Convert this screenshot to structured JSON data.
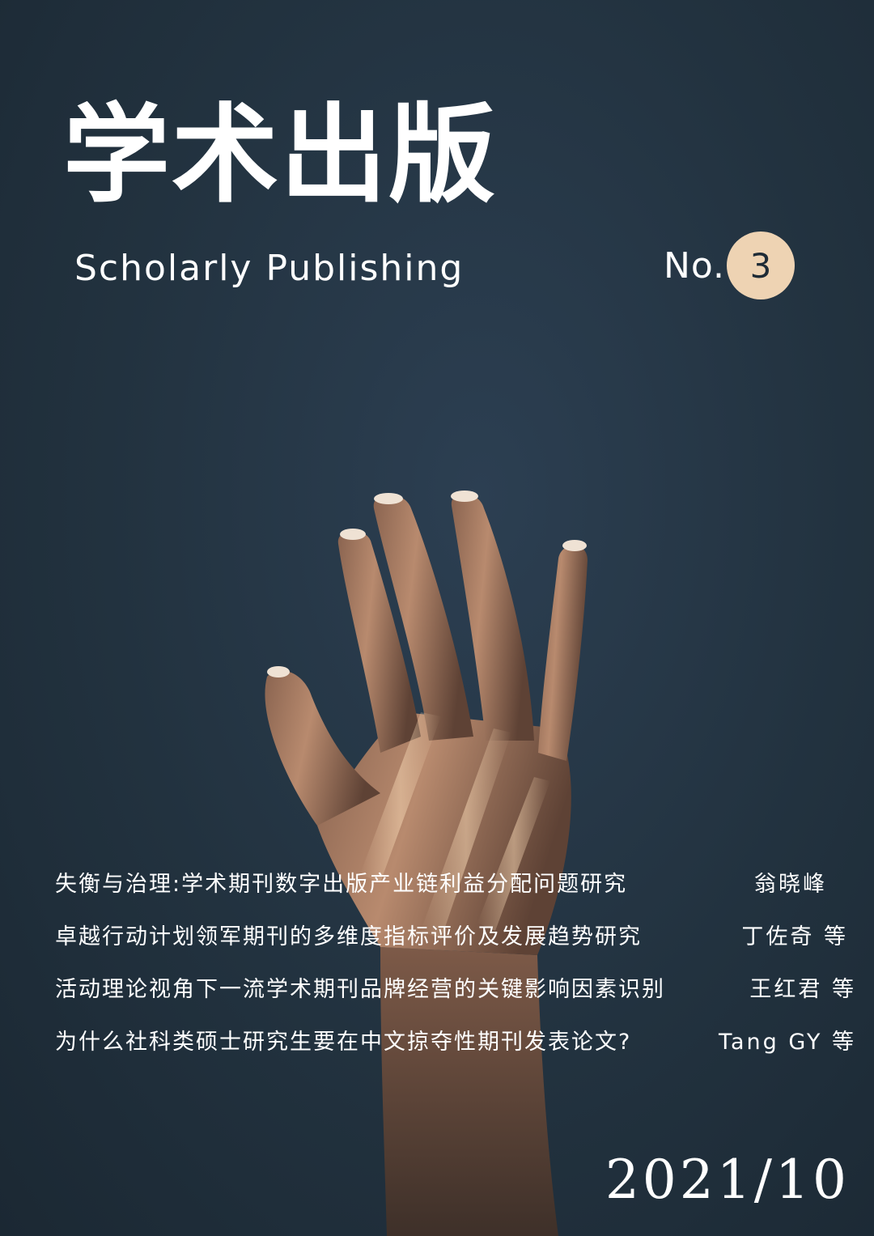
{
  "cover": {
    "title_cn": "学术出版",
    "title_en": "Scholarly Publishing",
    "issue_prefix": "No.",
    "issue_number": "3",
    "date": "2021/10",
    "colors": {
      "background": "#22323f",
      "issue_badge": "#eed3b3",
      "text": "#ffffff"
    },
    "image": "raised-hand-photo"
  },
  "articles": [
    {
      "title": "失衡与治理:学术期刊数字出版产业链利益分配问题研究",
      "author": "翁晓峰"
    },
    {
      "title": "卓越行动计划领军期刊的多维度指标评价及发展趋势研究",
      "author": "丁佐奇 等"
    },
    {
      "title": "活动理论视角下一流学术期刊品牌经营的关键影响因素识别",
      "author": "王红君 等"
    },
    {
      "title": "为什么社科类硕士研究生要在中文掠夺性期刊发表论文?",
      "author": "Tang GY 等"
    }
  ]
}
